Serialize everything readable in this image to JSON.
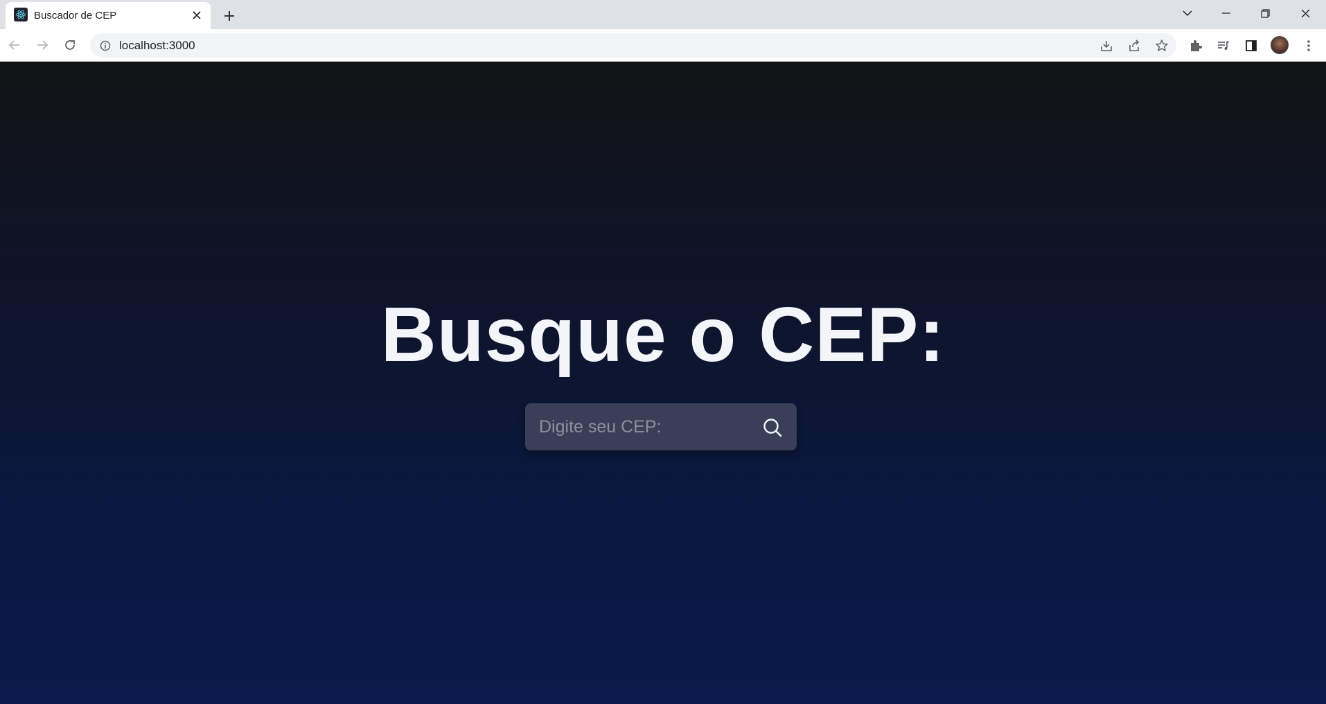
{
  "browser": {
    "tab": {
      "title": "Buscador de CEP",
      "favicon": "react-icon"
    },
    "address_bar": {
      "url": "localhost:3000"
    },
    "icons": {
      "back": "back-arrow-icon",
      "forward": "forward-arrow-icon",
      "reload": "reload-icon",
      "site_info": "info-icon",
      "install": "install-app-icon",
      "share": "share-icon",
      "bookmark": "star-icon",
      "extensions": "puzzle-icon",
      "media": "media-queue-icon",
      "side_panel": "side-panel-icon",
      "menu": "kebab-menu-icon"
    }
  },
  "page": {
    "title": "Busque o CEP:",
    "search": {
      "placeholder": "Digite seu CEP:",
      "value": "",
      "button_icon": "search-icon"
    }
  },
  "colors": {
    "background_top": "#131416",
    "background_bottom": "#0a1a4a",
    "heading": "#f4f5f9",
    "search_box": "#3a3f58",
    "placeholder": "#8c90a3"
  }
}
